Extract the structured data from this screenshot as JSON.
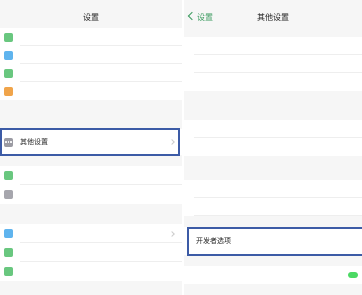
{
  "left": {
    "status": {
      "left": "",
      "center": "",
      "right": ""
    },
    "title": "设置",
    "items": [
      {
        "label": "",
        "icon": "green-app-icon",
        "color": "#69c77f"
      },
      {
        "label": "",
        "icon": "blue-app-icon",
        "color": "#5fb4ee"
      },
      {
        "label": "",
        "icon": "green-app-icon",
        "color": "#69c77f"
      },
      {
        "label": "",
        "icon": "orange-app-icon",
        "color": "#f0a44a"
      },
      {
        "label": "其他设置",
        "icon": "more-dots-icon",
        "color": "#9b9ba3"
      },
      {
        "label": "",
        "icon": "green-app-icon",
        "color": "#69c77f"
      },
      {
        "label": "",
        "icon": "gray-app-icon",
        "color": "#a6a6ad"
      },
      {
        "label": "",
        "icon": "blue-app-icon",
        "color": "#5fb4ee"
      },
      {
        "label": "",
        "icon": "green-app-icon",
        "color": "#69c77f"
      },
      {
        "label": "",
        "icon": "green-app-icon",
        "color": "#69c77f"
      }
    ]
  },
  "right": {
    "status": {
      "left": "",
      "center": "",
      "right": ""
    },
    "back_label": "设置",
    "title": "其他设置",
    "items": [
      {
        "label": ""
      },
      {
        "label": ""
      },
      {
        "label": ""
      },
      {
        "label": ""
      },
      {
        "label": ""
      },
      {
        "label": ""
      },
      {
        "label": ""
      },
      {
        "label": "开发者选项"
      },
      {
        "label": ""
      }
    ]
  },
  "colors": {
    "highlight": "#3c5ba6",
    "accent": "#3a9a5e",
    "toggle_on": "#4cd964"
  }
}
